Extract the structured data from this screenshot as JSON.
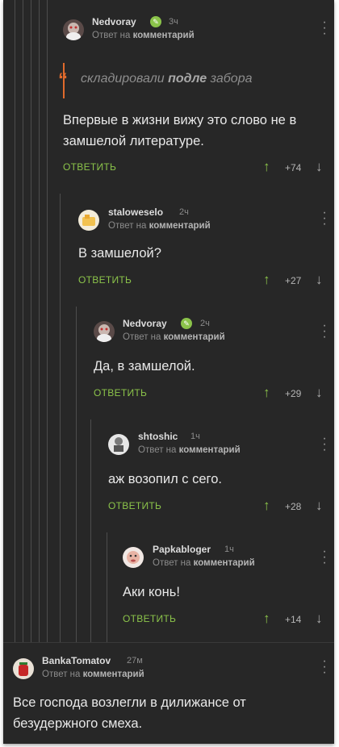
{
  "colors": {
    "accent": "#8bc34a",
    "quote_accent": "#e06a2c",
    "background": "#272727"
  },
  "icons": {
    "badge": "pencil-icon",
    "menu": "more-vertical-icon",
    "up": "arrow-up-icon",
    "down": "arrow-down-icon"
  },
  "comments": [
    {
      "author": "Nedvoray",
      "verified": true,
      "time": "3ч",
      "reply_prefix": "Ответ на",
      "reply_target": "комментарий",
      "quote": {
        "before": "складировали ",
        "bold": "подле",
        "after": " забора"
      },
      "body": "Впервые в жизни вижу это слово не в замшелой литературе.",
      "reply_label": "ОТВЕТИТЬ",
      "score": "+74"
    },
    {
      "author": "staloweselo",
      "verified": false,
      "time": "2ч",
      "reply_prefix": "Ответ на",
      "reply_target": "комментарий",
      "body": "В замшелой?",
      "reply_label": "ОТВЕТИТЬ",
      "score": "+27"
    },
    {
      "author": "Nedvoray",
      "verified": true,
      "time": "2ч",
      "reply_prefix": "Ответ на",
      "reply_target": "комментарий",
      "body": "Да, в замшелой.",
      "reply_label": "ОТВЕТИТЬ",
      "score": "+29"
    },
    {
      "author": "shtoshic",
      "verified": false,
      "time": "1ч",
      "reply_prefix": "Ответ на",
      "reply_target": "комментарий",
      "body": "аж возопил с сего.",
      "reply_label": "ОТВЕТИТЬ",
      "score": "+28"
    },
    {
      "author": "Papkabloger",
      "verified": false,
      "time": "1ч",
      "reply_prefix": "Ответ на",
      "reply_target": "комментарий",
      "body": "Аки конь!",
      "reply_label": "ОТВЕТИТЬ",
      "score": "+14"
    },
    {
      "author": "BankaTomatov",
      "verified": false,
      "time": "27м",
      "reply_prefix": "Ответ на",
      "reply_target": "комментарий",
      "body": "Все господа возлегли в дилижансе от безудержного смеха."
    }
  ]
}
